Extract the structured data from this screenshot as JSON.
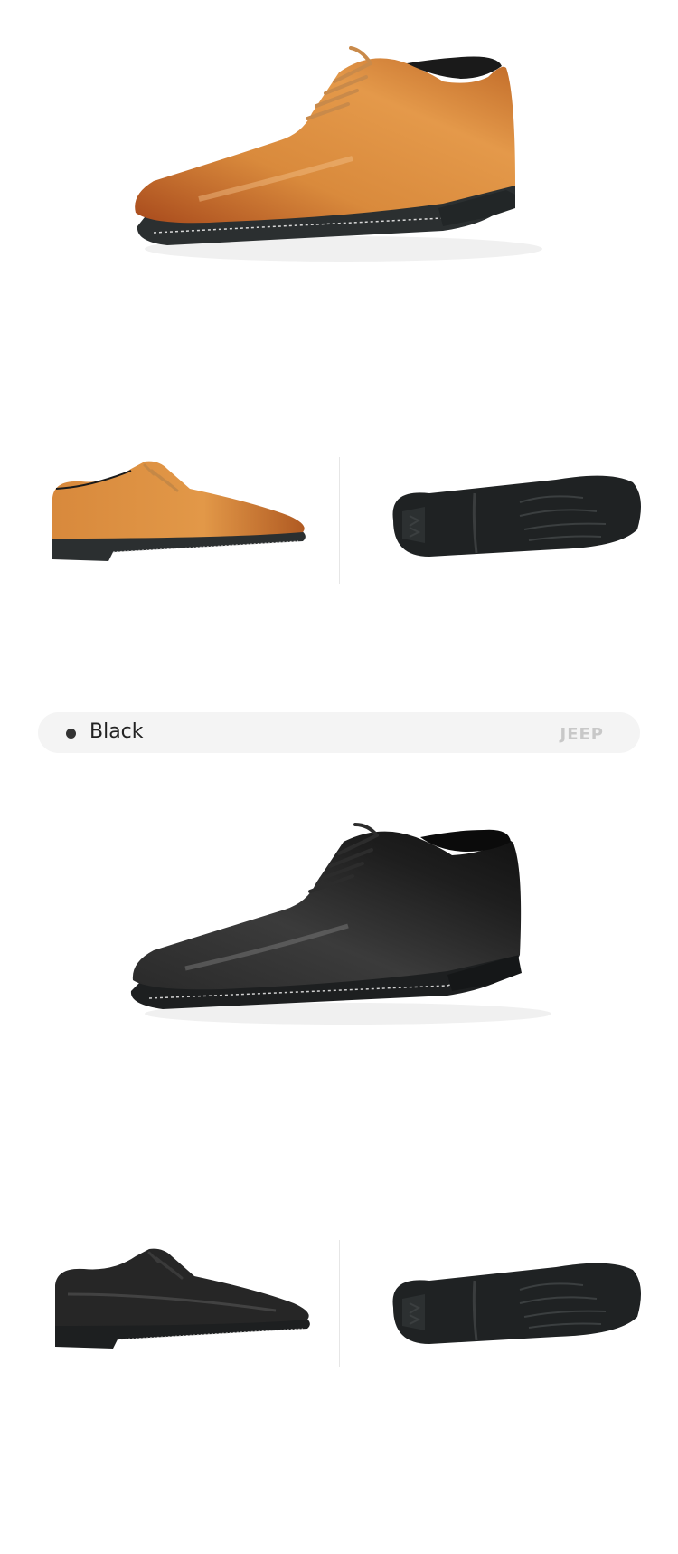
{
  "sections": [
    {
      "color_label": "Black",
      "brand": "JEEP"
    }
  ],
  "photos": {
    "hero_brown": "brown-oxford-shoe-three-quarter",
    "side_brown": "brown-oxford-shoe-side",
    "sole_brown": "black-rubber-sole-bottom",
    "hero_black": "black-oxford-shoe-three-quarter",
    "side_black": "black-oxford-shoe-side",
    "sole_black": "black-rubber-sole-bottom"
  },
  "colors": {
    "brown_leather": "#c9752b",
    "black_leather": "#1c1c1c",
    "sole": "#2b2f30",
    "bar_bg": "#f4f4f4",
    "brand_text": "#c8c8c8"
  }
}
